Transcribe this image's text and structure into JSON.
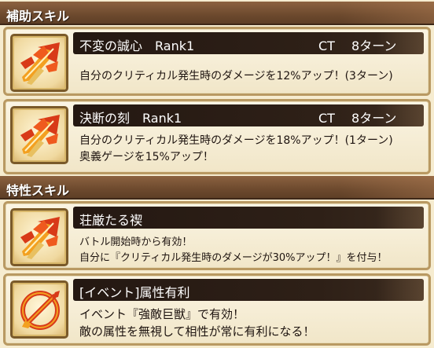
{
  "sections": {
    "support": {
      "title": "補助スキル"
    },
    "trait": {
      "title": "特性スキル"
    }
  },
  "skills": [
    {
      "name": "不変の誠心　Rank1",
      "ct": "CT　 8ターン",
      "desc": [
        "自分のクリティカル発生時のダメージを12%アップ！(3ターン)"
      ],
      "icon": "critical-sword-icon"
    },
    {
      "name": "決断の刻　Rank1",
      "ct": "CT　 8ターン",
      "desc": [
        "自分のクリティカル発生時のダメージを18%アップ！(1ターン)",
        "奥義ゲージを15%アップ！"
      ],
      "icon": "critical-sword-icon"
    }
  ],
  "traits": [
    {
      "name": "荘厳たる禊",
      "desc": [
        "バトル開始時から有効！",
        "自分に『クリティカル発生時のダメージが30%アップ！』を付与！"
      ],
      "icon": "critical-sword-icon"
    },
    {
      "name": "[イベント]属性有利",
      "desc": [
        "イベント『強敵巨獣』で有効！",
        "敵の属性を無視して相性が常に有利になる！"
      ],
      "icon": "attribute-advantage-icon"
    }
  ],
  "colors": {
    "header_bg": "#6d4a2e",
    "name_bar_bg": "#241812",
    "card_bg": "#fbf5e4",
    "card_border": "#b99962",
    "icon_red": "#d83a18",
    "icon_orange": "#f3a020"
  }
}
